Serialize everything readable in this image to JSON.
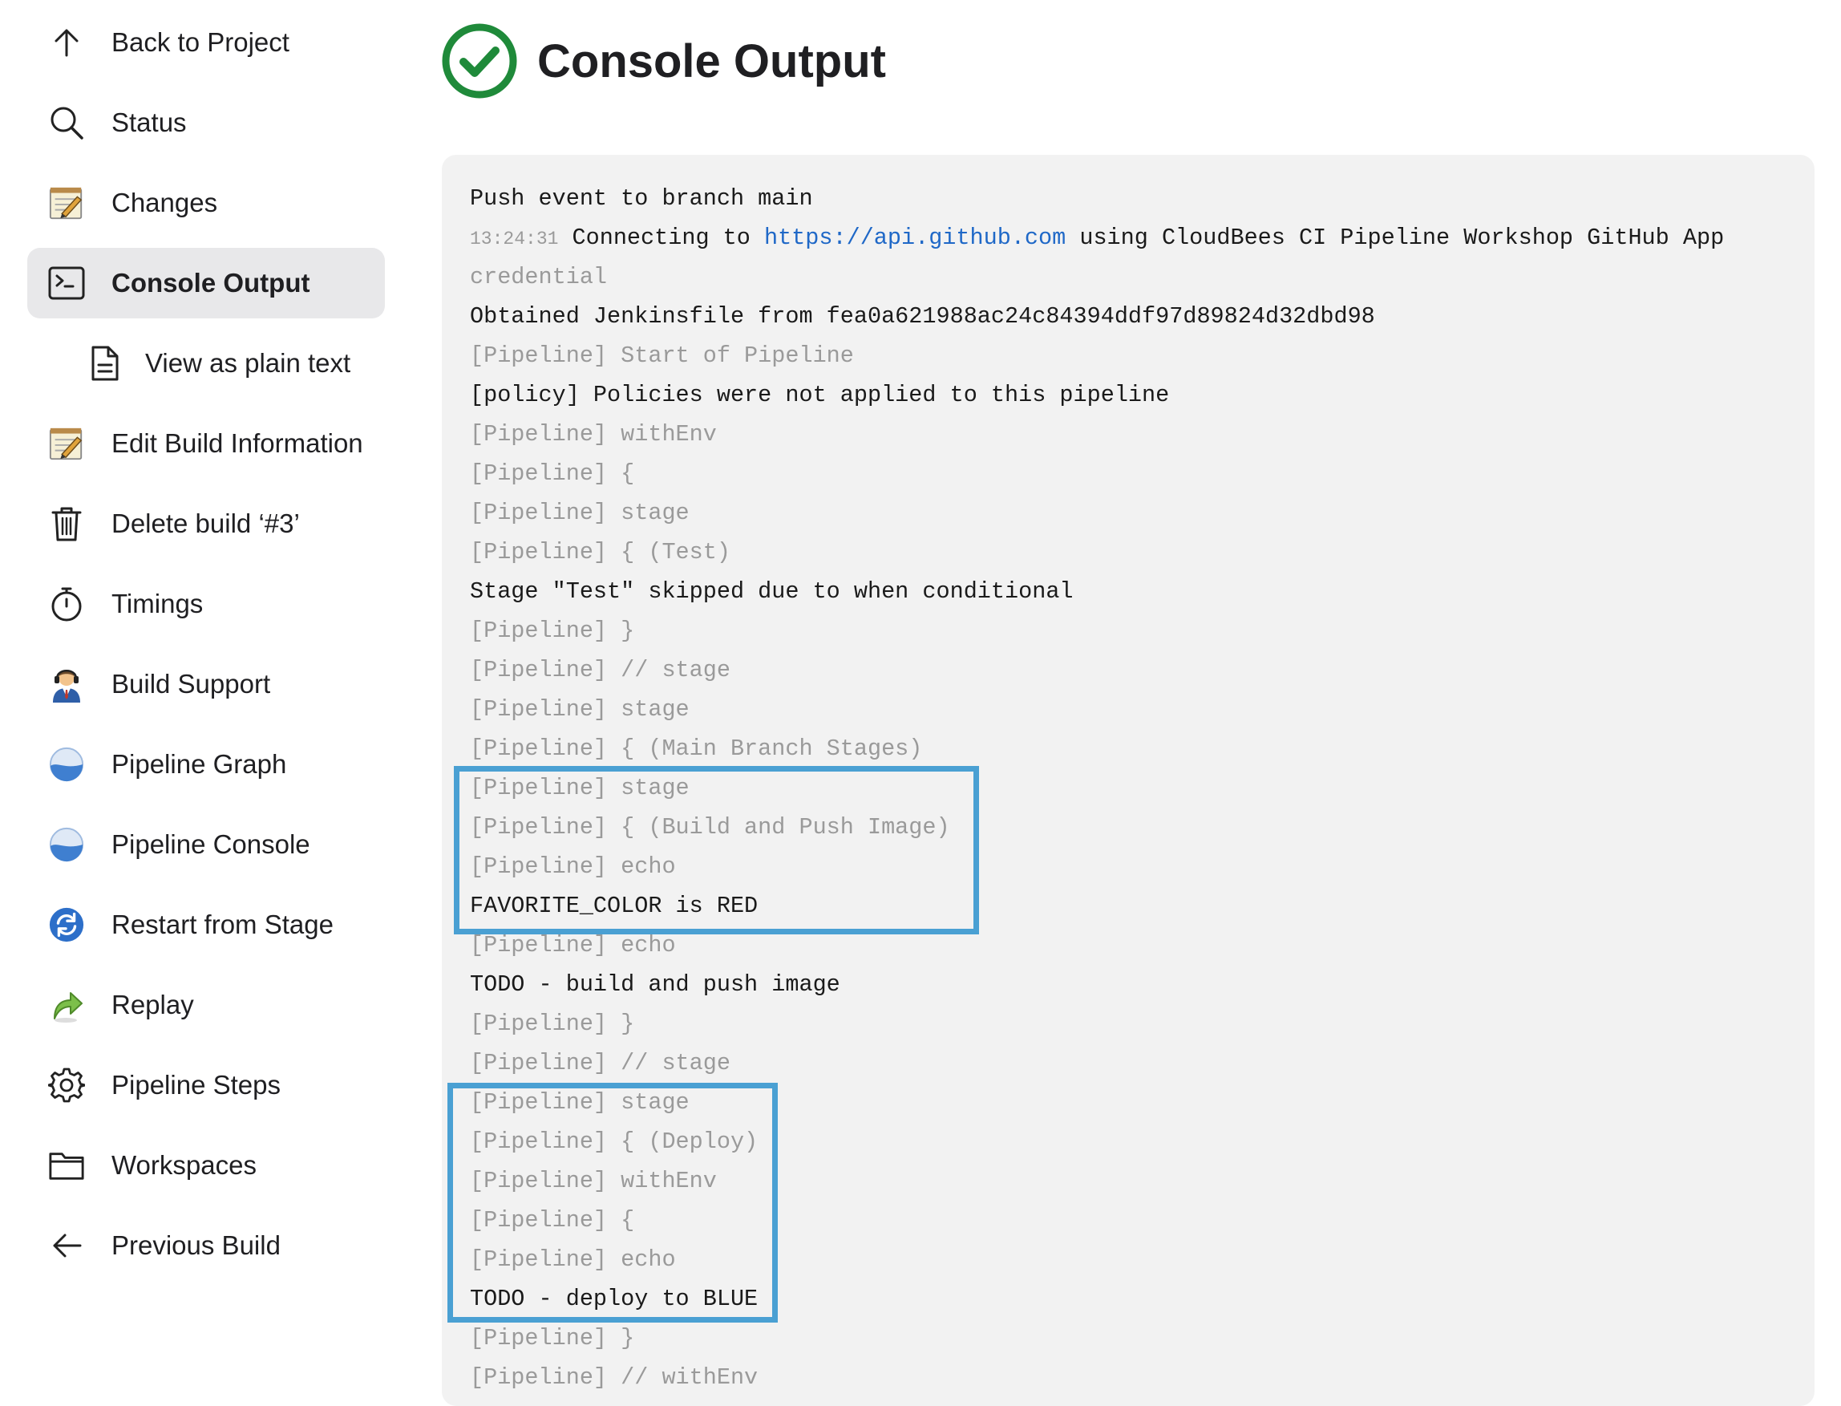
{
  "sidebar": {
    "items": [
      {
        "label": "Back to Project",
        "icon": "arrow-up-icon"
      },
      {
        "label": "Status",
        "icon": "magnifier-icon"
      },
      {
        "label": "Changes",
        "icon": "notepad-icon"
      },
      {
        "label": "Console Output",
        "icon": "terminal-icon",
        "active": true
      },
      {
        "label": "View as plain text",
        "icon": "document-icon",
        "sub": true
      },
      {
        "label": "Edit Build Information",
        "icon": "notepad-icon"
      },
      {
        "label": "Delete build ‘#3’",
        "icon": "trash-icon"
      },
      {
        "label": "Timings",
        "icon": "stopwatch-icon"
      },
      {
        "label": "Build Support",
        "icon": "support-agent-icon"
      },
      {
        "label": "Pipeline Graph",
        "icon": "pipeline-graph-icon"
      },
      {
        "label": "Pipeline Console",
        "icon": "pipeline-console-icon"
      },
      {
        "label": "Restart from Stage",
        "icon": "restart-icon"
      },
      {
        "label": "Replay",
        "icon": "replay-arrow-icon"
      },
      {
        "label": "Pipeline Steps",
        "icon": "gear-icon"
      },
      {
        "label": "Workspaces",
        "icon": "folder-icon"
      },
      {
        "label": "Previous Build",
        "icon": "arrow-left-icon"
      }
    ]
  },
  "header": {
    "title": "Console Output",
    "status_icon": "success-check-icon",
    "status_color": "#1f8a3a"
  },
  "console": {
    "line_0": "Push event to branch main",
    "line_1_timestamp": "13:24:31",
    "line_1_before": " Connecting to ",
    "line_1_link": "https://api.github.com",
    "line_1_after": " using CloudBees CI Pipeline Workshop GitHub App",
    "line_1_cont": "credential",
    "line_2": "Obtained Jenkinsfile from fea0a621988ac24c84394ddf97d89824d32dbd98",
    "line_3": "[Pipeline] Start of Pipeline",
    "line_4": "[policy] Policies were not applied to this pipeline",
    "line_5": "[Pipeline] withEnv",
    "line_6": "[Pipeline] {",
    "line_7": "[Pipeline] stage",
    "line_8": "[Pipeline] { (Test)",
    "line_9": "Stage \"Test\" skipped due to when conditional",
    "line_10": "[Pipeline] }",
    "line_11": "[Pipeline] // stage",
    "line_12": "[Pipeline] stage",
    "line_13": "[Pipeline] { (Main Branch Stages)",
    "line_14": "[Pipeline] stage",
    "line_15": "[Pipeline] { (Build and Push Image)",
    "line_16": "[Pipeline] echo",
    "line_17": "FAVORITE_COLOR is RED",
    "line_18": "[Pipeline] echo",
    "line_19": "TODO - build and push image",
    "line_20": "[Pipeline] }",
    "line_21": "[Pipeline] // stage",
    "line_22": "[Pipeline] stage",
    "line_23": "[Pipeline] { (Deploy)",
    "line_24": "[Pipeline] withEnv",
    "line_25": "[Pipeline] {",
    "line_26": "[Pipeline] echo",
    "line_27": "TODO - deploy to BLUE",
    "line_28": "[Pipeline] }",
    "line_29": "[Pipeline] // withEnv"
  },
  "colors": {
    "highlight_border": "#4aa0d3",
    "link": "#1f68c7",
    "console_bg": "#f2f2f2",
    "active_item_bg": "#e8e8ea"
  }
}
